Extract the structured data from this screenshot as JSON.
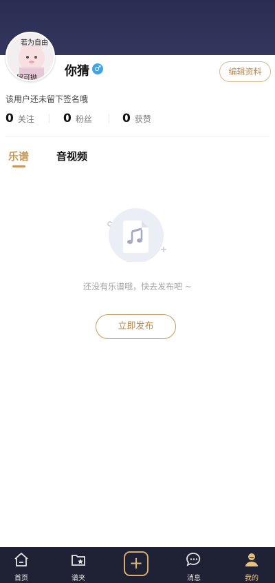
{
  "profile": {
    "avatar_caption_top": "若为自由",
    "avatar_caption_bottom": "故留可抛",
    "nickname": "你猜",
    "gender_icon": "male-icon",
    "edit_label": "编辑资料",
    "signature": "该用户还未留下签名哦",
    "stats": [
      {
        "value": "0",
        "label": "关注"
      },
      {
        "value": "0",
        "label": "粉丝"
      },
      {
        "value": "0",
        "label": "获赞"
      }
    ]
  },
  "tabs": [
    {
      "label": "乐谱",
      "active": true
    },
    {
      "label": "音视频",
      "active": false
    }
  ],
  "empty_state": {
    "icon": "music-note-file-icon",
    "message": "还没有乐谱哦，快去发布吧 ~",
    "action_label": "立即发布"
  },
  "bottom_nav": {
    "items": [
      {
        "label": "首页",
        "icon": "home-icon"
      },
      {
        "label": "谱夹",
        "icon": "folder-star-icon"
      },
      {
        "label": "",
        "icon": "add-icon"
      },
      {
        "label": "消息",
        "icon": "message-icon"
      },
      {
        "label": "我的",
        "icon": "profile-icon",
        "active": true
      }
    ]
  },
  "colors": {
    "header": "#2b2d52",
    "accent": "#c79757",
    "nav_bg": "#1f2135",
    "gender_badge": "#3fa3e8"
  }
}
